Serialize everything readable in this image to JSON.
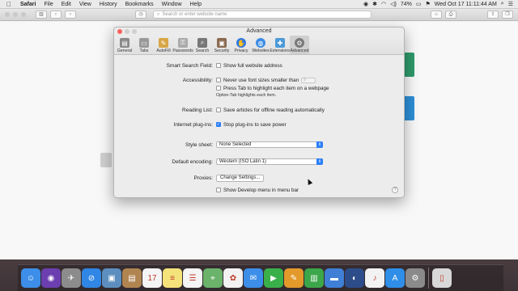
{
  "menubar": {
    "app_name": "Safari",
    "items": [
      "File",
      "Edit",
      "View",
      "History",
      "Bookmarks",
      "Window",
      "Help"
    ],
    "battery": "74%",
    "clock": "Wed Oct 17  11:11:44 AM"
  },
  "browser": {
    "address_placeholder": "Search or enter website name"
  },
  "prefs": {
    "title": "Advanced",
    "tabs": [
      {
        "label": "General",
        "icon": "general-icon",
        "color": "#8a8a8a"
      },
      {
        "label": "Tabs",
        "icon": "tabs-icon",
        "color": "#9a9a9a"
      },
      {
        "label": "AutoFill",
        "icon": "pencil-icon",
        "color": "#d8a645"
      },
      {
        "label": "Passwords",
        "icon": "key-icon",
        "color": "#aaaaaa"
      },
      {
        "label": "Search",
        "icon": "magnifier-icon",
        "color": "#777777"
      },
      {
        "label": "Security",
        "icon": "lock-icon",
        "color": "#8a6a50"
      },
      {
        "label": "Privacy",
        "icon": "hand-icon",
        "color": "#2e78e0"
      },
      {
        "label": "Websites",
        "icon": "globe-icon",
        "color": "#3b8de6"
      },
      {
        "label": "Extensions",
        "icon": "puzzle-icon",
        "color": "#4d9bd8"
      },
      {
        "label": "Advanced",
        "icon": "gear-icon",
        "color": "#7a7a7a"
      }
    ],
    "smart_search_label": "Smart Search Field:",
    "smart_search_option": "Show full website address",
    "accessibility_label": "Accessibility:",
    "font_size_option": "Never use font sizes smaller than",
    "font_size_value": "9",
    "tab_highlight_option": "Press Tab to highlight each item on a webpage",
    "tab_highlight_note": "Option-Tab highlights each item.",
    "reading_list_label": "Reading List:",
    "reading_list_option": "Save articles for offline reading automatically",
    "plugins_label": "Internet plug-ins:",
    "plugins_option": "Stop plug-ins to save power",
    "stylesheet_label": "Style sheet:",
    "stylesheet_value": "None Selected",
    "encoding_label": "Default encoding:",
    "encoding_value": "Western (ISO Latin 1)",
    "proxies_label": "Proxies:",
    "proxies_button": "Change Settings...",
    "develop_option": "Show Develop menu in menu bar",
    "help_glyph": "?"
  },
  "dock": [
    {
      "name": "finder",
      "color": "#3c8ee8",
      "glyph": "☺"
    },
    {
      "name": "siri",
      "color": "#6b3fb0",
      "glyph": "◉"
    },
    {
      "name": "launchpad",
      "color": "#8c8c8c",
      "glyph": "✈"
    },
    {
      "name": "safari",
      "color": "#2f86e5",
      "glyph": "⊘"
    },
    {
      "name": "preview",
      "color": "#5c8fbf",
      "glyph": "▣"
    },
    {
      "name": "notes-contacts",
      "color": "#b08550",
      "glyph": "▤"
    },
    {
      "name": "calendar",
      "color": "#f4f4f4",
      "glyph": "17"
    },
    {
      "name": "notes",
      "color": "#f4e37a",
      "glyph": "≡"
    },
    {
      "name": "reminders",
      "color": "#f4f4f4",
      "glyph": "☰"
    },
    {
      "name": "maps",
      "color": "#6bb36b",
      "glyph": "⌖"
    },
    {
      "name": "photos",
      "color": "#f2f2f2",
      "glyph": "✿"
    },
    {
      "name": "messages",
      "color": "#3c8ee8",
      "glyph": "✉"
    },
    {
      "name": "facetime",
      "color": "#3ab04a",
      "glyph": "▶"
    },
    {
      "name": "pages",
      "color": "#e39a2b",
      "glyph": "✎"
    },
    {
      "name": "numbers",
      "color": "#3ca64a",
      "glyph": "▥"
    },
    {
      "name": "keynote",
      "color": "#3f7fd6",
      "glyph": "▬"
    },
    {
      "name": "quicktime",
      "color": "#2d4d8a",
      "glyph": "◐"
    },
    {
      "name": "itunes",
      "color": "#f2f2f2",
      "glyph": "♪"
    },
    {
      "name": "app-store",
      "color": "#2f8ee8",
      "glyph": "A"
    },
    {
      "name": "system-preferences",
      "color": "#8a8a8a",
      "glyph": "⚙"
    },
    {
      "name": "trash",
      "color": "#d8d8d8",
      "glyph": "▯"
    }
  ]
}
